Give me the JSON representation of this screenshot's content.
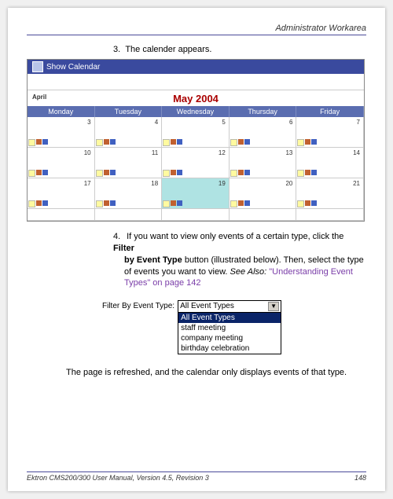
{
  "header": {
    "section": "Administrator Workarea"
  },
  "steps": {
    "s3": {
      "num": "3.",
      "text": "The calender appears."
    },
    "s4": {
      "num": "4.",
      "line1a": "If you want to view only events of a certain type, click the ",
      "line1b": "Filter",
      "line2a": "by Event Type",
      "line2b": " button (illustrated below). Then, select the type",
      "line3a": "of events you want to view. ",
      "line3b": "See Also:",
      "line3c": " \"Understanding Event",
      "line4": "Types\" on page 142"
    }
  },
  "calendar": {
    "title_bar": "Show Calendar",
    "month": "May 2004",
    "nav_prev": "April",
    "days": [
      "Monday",
      "Tuesday",
      "Wednesday",
      "Thursday",
      "Friday"
    ],
    "cells": {
      "r1": [
        "3",
        "4",
        "5",
        "6",
        "7"
      ],
      "r2": [
        "10",
        "11",
        "12",
        "13",
        "14"
      ],
      "r3": [
        "17",
        "18",
        "19",
        "20",
        "21"
      ]
    }
  },
  "filter": {
    "label": "Filter By Event Type:",
    "selected": "All Event Types",
    "options": [
      "All Event Types",
      "staff meeting",
      "company meeting",
      "birthday celebration"
    ]
  },
  "after_para": "The page is refreshed, and the calendar only displays events of that type.",
  "footer": {
    "left": "Ektron CMS200/300 User Manual, Version 4.5, Revision 3",
    "right": "148"
  }
}
